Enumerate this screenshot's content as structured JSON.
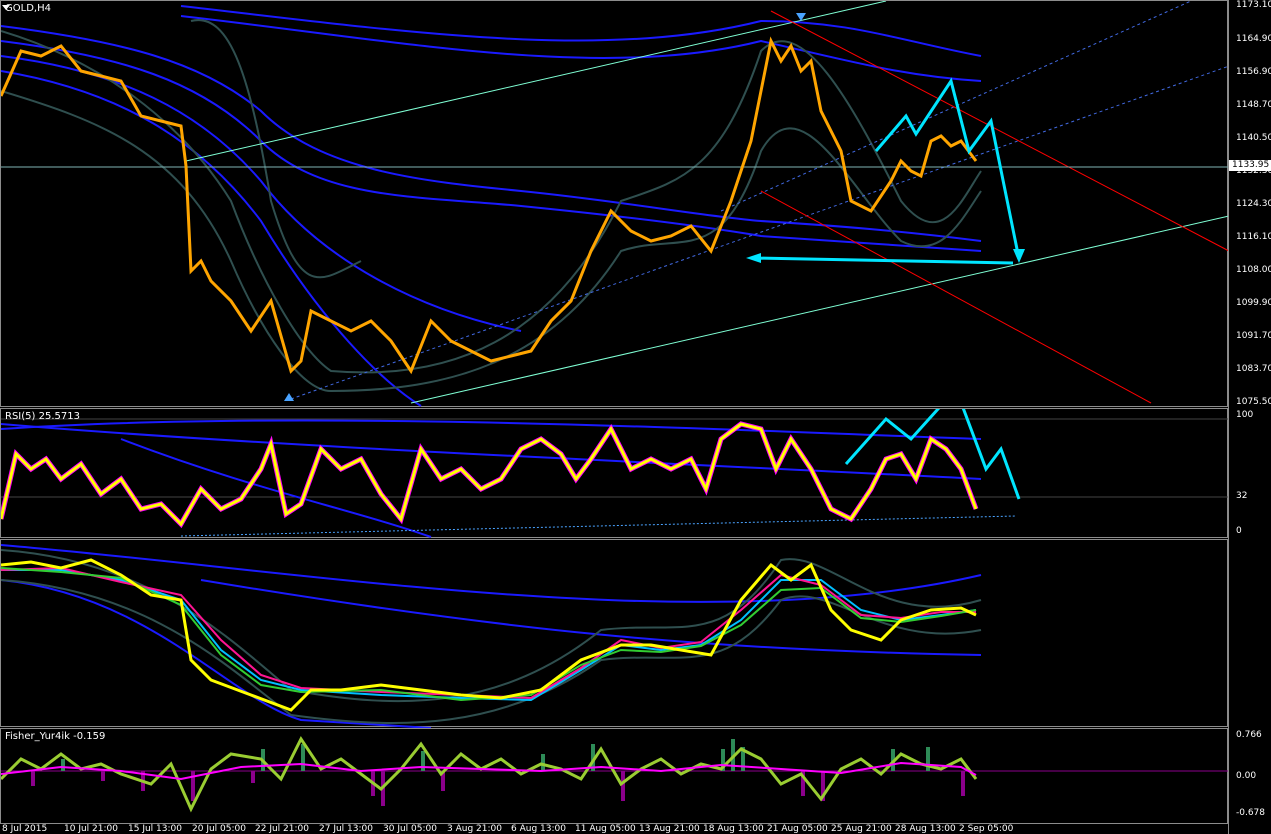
{
  "main_chart": {
    "title": "GOLD,H4",
    "current_price": "1133.95",
    "y_labels": [
      "1173.10",
      "1164.90",
      "1156.90",
      "1148.70",
      "1140.50",
      "1132.30",
      "1124.30",
      "1116.10",
      "1108.00",
      "1099.90",
      "1091.70",
      "1083.70",
      "1075.50"
    ]
  },
  "rsi_pane": {
    "title": "RSI(5) 25.5713",
    "y_labels": [
      "100",
      "32",
      "0"
    ]
  },
  "fisher_pane": {
    "title": "Fisher_Yur4ik -0.159",
    "y_labels": [
      "0.766",
      "0.00",
      "-0.678"
    ]
  },
  "x_axis": {
    "labels": [
      "8 Jul 2015",
      "10 Jul 21:00",
      "15 Jul 13:00",
      "20 Jul 05:00",
      "22 Jul 21:00",
      "27 Jul 13:00",
      "30 Jul 05:00",
      "3 Aug 21:00",
      "6 Aug 13:00",
      "11 Aug 05:00",
      "13 Aug 21:00",
      "18 Aug 13:00",
      "21 Aug 05:00",
      "25 Aug 21:00",
      "28 Aug 13:00",
      "2 Sep 05:00"
    ]
  },
  "colors": {
    "candle_up": "#ffa500",
    "candle_down": "#ff6a00",
    "annotation": "#00e5ff",
    "rsi_line": "#ffff00",
    "rsi_overlay": "#ff00ff",
    "ma_blue": "#1a1aff",
    "channel_cyan": "#7fffd4",
    "channel_red": "#ff0000",
    "fisher_green": "#9acd32",
    "fisher_hist_up": "#2e8b57",
    "fisher_hist_down": "#8b008b"
  }
}
